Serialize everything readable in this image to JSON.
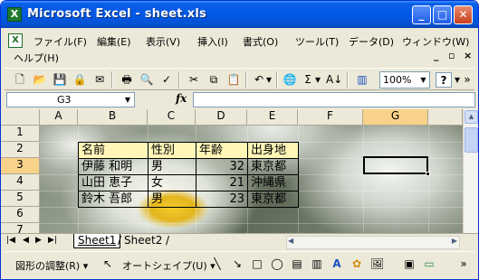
{
  "window": {
    "title": "Microsoft Excel - sheet.xls",
    "app_icon": "X",
    "min": "_",
    "max": "□",
    "close": "✕"
  },
  "menu": {
    "doc_icon": "X",
    "items": [
      "ファイル(F)",
      "編集(E)",
      "表示(V)",
      "挿入(I)",
      "書式(O)",
      "ツール(T)",
      "データ(D)",
      "ウィンドウ(W)",
      "ヘルプ(H)"
    ],
    "doc_min": "_",
    "doc_restore": "▫",
    "doc_close": "×"
  },
  "toolbar": {
    "icons": [
      "new-icon",
      "open-icon",
      "save-icon",
      "permission-icon",
      "email-icon",
      "print-icon",
      "print-preview-icon",
      "spelling-icon",
      "cut-icon",
      "copy-icon",
      "paste-icon",
      "undo-icon",
      "hyperlink-icon",
      "autosum-icon",
      "sort-ascending-icon",
      "chart-wizard-icon",
      "help-icon"
    ],
    "glyphs": {
      "new": "🗋",
      "open": "📂",
      "save": "💾",
      "permission": "🔒",
      "email": "✉",
      "print": "🖶",
      "preview": "🔍",
      "spelling": "✓",
      "cut": "✂",
      "copy": "⧉",
      "paste": "📋",
      "undo": "↶",
      "undo_dd": "▾",
      "link": "🌐",
      "autosum": "Σ",
      "autosum_dd": "▾",
      "sort": "A↓",
      "chart": "▥",
      "help": "?",
      "help_dd": "▾",
      "more": "»"
    },
    "zoom": "100%",
    "zoom_arrow": "▼"
  },
  "formula": {
    "name_box": "G3",
    "name_arrow": "▼",
    "fx": "fx",
    "value": ""
  },
  "sheet": {
    "columns": [
      "A",
      "B",
      "C",
      "D",
      "E",
      "F",
      "G"
    ],
    "rows": [
      "1",
      "2",
      "3",
      "4",
      "5",
      "6",
      "7"
    ],
    "selected_column": "G",
    "selected_row": "3",
    "headers": [
      "名前",
      "性別",
      "年齢",
      "出身地"
    ],
    "data": [
      [
        "伊藤 和明",
        "男",
        "32",
        "東京都"
      ],
      [
        "山田 恵子",
        "女",
        "21",
        "沖縄県"
      ],
      [
        "鈴木 吾郎",
        "男",
        "23",
        "東京都"
      ]
    ],
    "active_cell": "G3"
  },
  "tabs": {
    "sheets": [
      "Sheet1",
      "Sheet2"
    ],
    "active": "Sheet1",
    "nav": [
      "|◀",
      "◀",
      "▶",
      "▶|"
    ],
    "divider": "/",
    "hscroll_left": "◀",
    "hscroll_right": "▶"
  },
  "vscroll": {
    "up": "▲",
    "down": "▼"
  },
  "drawing_toolbar": {
    "draw_menu": "図形の調整(R) ▾",
    "select_arrow": "↖",
    "autoshapes": "オートシェイプ(U) ▾",
    "glyphs": {
      "line": "╲",
      "arrow": "↘",
      "rect": "□",
      "oval": "◯",
      "textbox": "▤",
      "vertical_text": "▥",
      "wordart": "A",
      "diagram": "✿",
      "clipart": "🖼",
      "image": "▣",
      "fill": "🪣",
      "shapes3d": "▭",
      "more": "»"
    }
  }
}
